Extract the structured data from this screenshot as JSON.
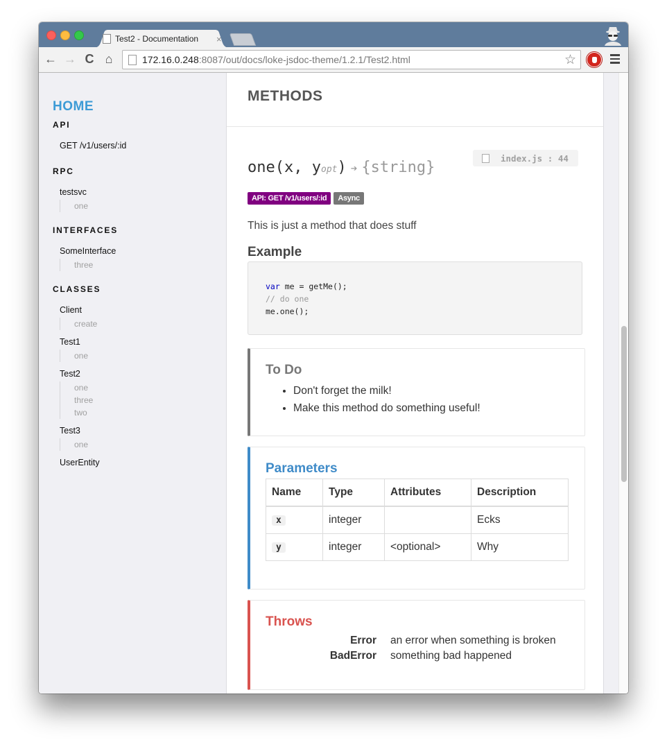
{
  "browser": {
    "tab_title": "Test2 - Documentation",
    "tab_close": "×",
    "url_host": "172.16.0.248",
    "url_rest": ":8087/out/docs/loke-jsdoc-theme/1.2.1/Test2.html",
    "icons": {
      "back": "←",
      "forward": "→",
      "reload": "C",
      "home": "⌂",
      "star": "☆"
    }
  },
  "sidebar": {
    "home": "HOME",
    "sections": [
      {
        "title": "API",
        "items": [
          {
            "label": "GET /v1/users/:id",
            "members": []
          }
        ]
      },
      {
        "title": "RPC",
        "items": [
          {
            "label": "testsvc",
            "members": [
              "one"
            ]
          }
        ]
      },
      {
        "title": "INTERFACES",
        "items": [
          {
            "label": "SomeInterface",
            "members": [
              "three"
            ]
          }
        ]
      },
      {
        "title": "CLASSES",
        "items": [
          {
            "label": "Client",
            "members": [
              "create"
            ]
          },
          {
            "label": "Test1",
            "members": [
              "one"
            ]
          },
          {
            "label": "Test2",
            "members": [
              "one",
              "three",
              "two"
            ]
          },
          {
            "label": "Test3",
            "members": [
              "one"
            ]
          },
          {
            "label": "UserEntity",
            "members": []
          }
        ]
      }
    ]
  },
  "main": {
    "section_title": "METHODS",
    "source": {
      "file": "index.js",
      "sep": ":",
      "line": "44"
    },
    "signature": {
      "name": "one",
      "open": "(",
      "param1": "x, ",
      "param2": "y",
      "opt": "opt",
      "close": ")",
      "arrow": "➔",
      "returns": "{string}"
    },
    "badges": {
      "api": "API: GET /v1/users/:id",
      "async": "Async"
    },
    "description": "This is just a method that does stuff",
    "example_title": "Example",
    "code": {
      "kw": "var",
      "line1_rest": " me = getMe();",
      "line2": "// do one",
      "line3": "me.one();"
    },
    "todo": {
      "title": "To Do",
      "items": [
        "Don't forget the milk!",
        "Make this method do something useful!"
      ]
    },
    "parameters": {
      "title": "Parameters",
      "headers": [
        "Name",
        "Type",
        "Attributes",
        "Description"
      ],
      "rows": [
        {
          "name": "x",
          "type": "integer",
          "attributes": "",
          "description": "Ecks"
        },
        {
          "name": "y",
          "type": "integer",
          "attributes": "<optional>",
          "description": "Why"
        }
      ]
    },
    "throws": {
      "title": "Throws",
      "items": [
        {
          "type": "Error",
          "description": "an error when something is broken"
        },
        {
          "type": "BadError",
          "description": "something bad happened"
        }
      ]
    }
  },
  "colors": {
    "home": "#3d9bd6",
    "api_badge": "#800080",
    "async_badge": "#777777",
    "params_accent": "#3f8bc8",
    "throws_accent": "#d9534f",
    "todo_accent": "#777777"
  }
}
